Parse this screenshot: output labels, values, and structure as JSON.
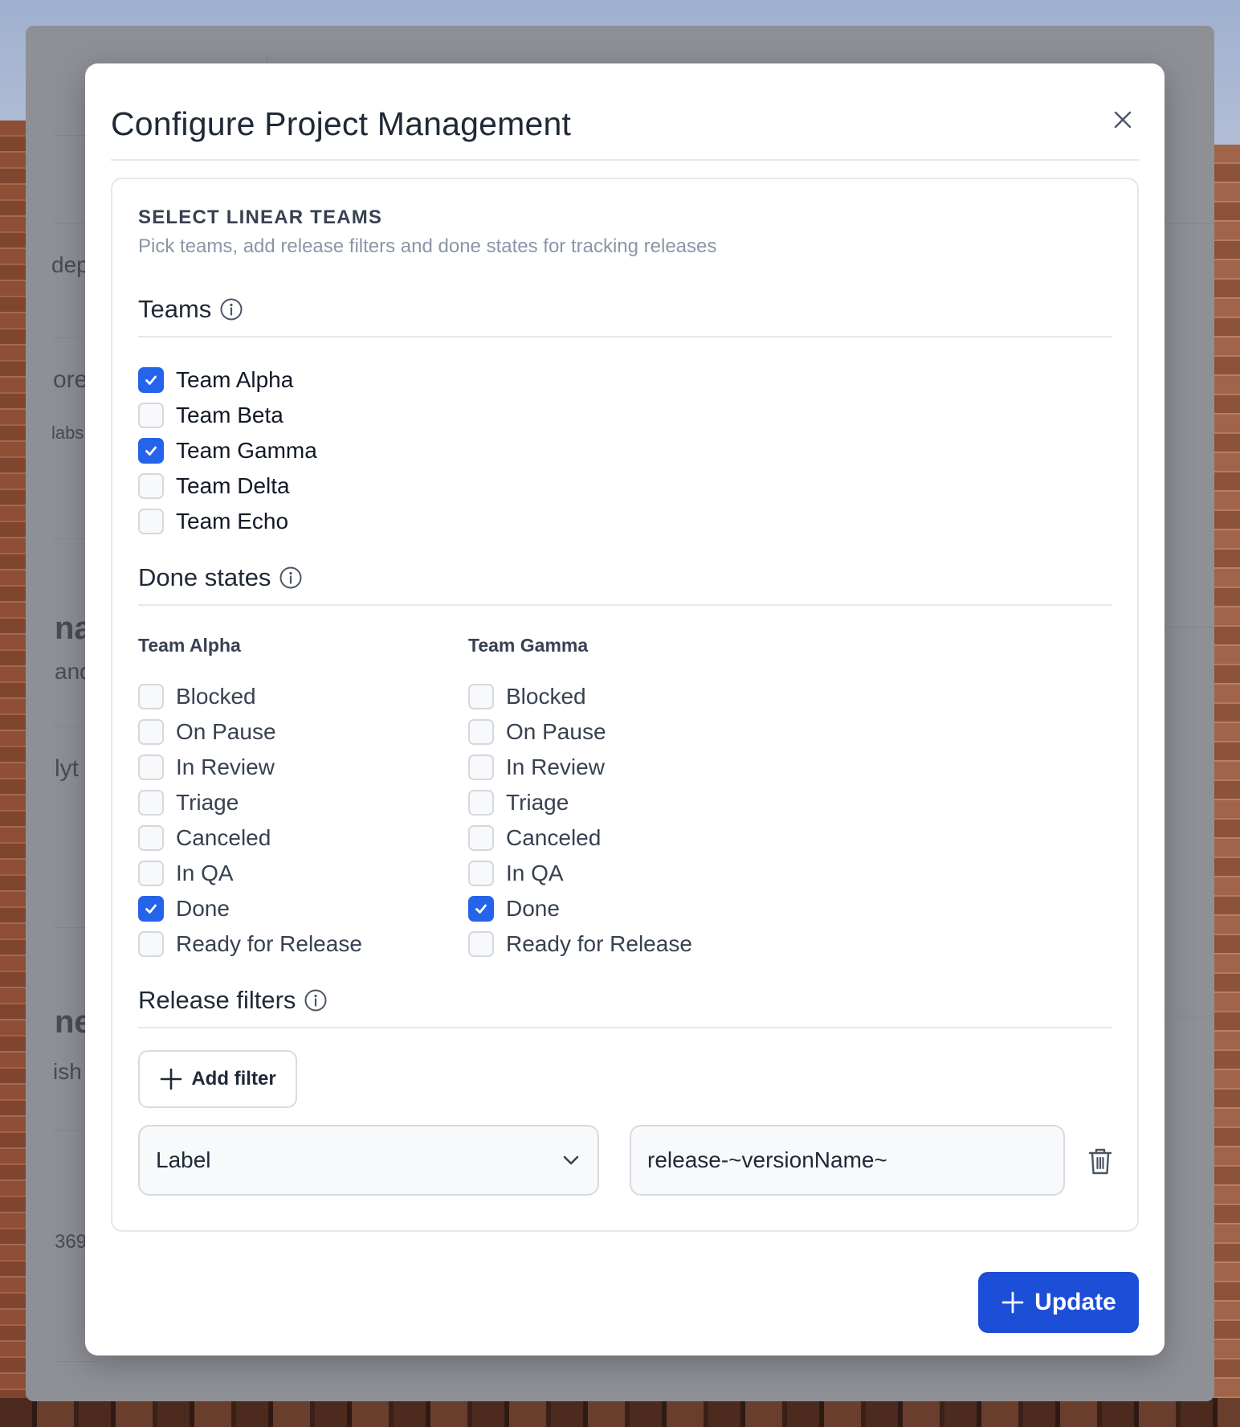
{
  "background_app": {
    "fragments": [
      "dep",
      "ore",
      "labs",
      "na",
      "and",
      "lyt",
      "ne",
      "ish",
      "369"
    ]
  },
  "modal": {
    "title": "Configure Project Management",
    "close_icon": "close-icon"
  },
  "section": {
    "eyebrow": "SELECT LINEAR TEAMS",
    "description": "Pick teams, add release filters and done states for tracking releases"
  },
  "teams": {
    "title": "Teams",
    "items": [
      {
        "label": "Team Alpha",
        "checked": true
      },
      {
        "label": "Team Beta",
        "checked": false
      },
      {
        "label": "Team Gamma",
        "checked": true
      },
      {
        "label": "Team Delta",
        "checked": false
      },
      {
        "label": "Team Echo",
        "checked": false
      }
    ]
  },
  "done_states": {
    "title": "Done states",
    "columns": [
      {
        "team": "Team Alpha",
        "states": [
          {
            "label": "Blocked",
            "checked": false
          },
          {
            "label": "On Pause",
            "checked": false
          },
          {
            "label": "In Review",
            "checked": false
          },
          {
            "label": "Triage",
            "checked": false
          },
          {
            "label": "Canceled",
            "checked": false
          },
          {
            "label": "In QA",
            "checked": false
          },
          {
            "label": "Done",
            "checked": true
          },
          {
            "label": "Ready for Release",
            "checked": false
          }
        ]
      },
      {
        "team": "Team Gamma",
        "states": [
          {
            "label": "Blocked",
            "checked": false
          },
          {
            "label": "On Pause",
            "checked": false
          },
          {
            "label": "In Review",
            "checked": false
          },
          {
            "label": "Triage",
            "checked": false
          },
          {
            "label": "Canceled",
            "checked": false
          },
          {
            "label": "In QA",
            "checked": false
          },
          {
            "label": "Done",
            "checked": true
          },
          {
            "label": "Ready for Release",
            "checked": false
          }
        ]
      }
    ]
  },
  "release_filters": {
    "title": "Release filters",
    "add_label": "Add filter",
    "filter": {
      "field": "Label",
      "value": "release-~versionName~"
    }
  },
  "footer": {
    "update_label": "Update"
  },
  "colors": {
    "accent": "#2563eb",
    "primary_button": "#1d4ed8"
  }
}
